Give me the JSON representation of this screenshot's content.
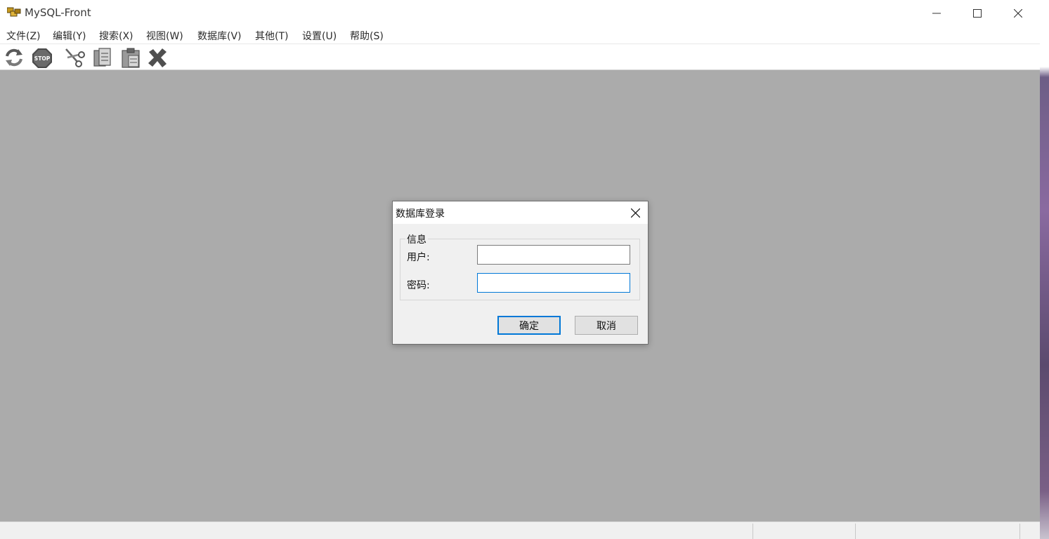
{
  "app": {
    "title": "MySQL-Front"
  },
  "window_controls": {
    "minimize_icon": "minimize-icon",
    "maximize_icon": "maximize-icon",
    "close_icon": "close-icon"
  },
  "menu": {
    "items": [
      "文件(Z)",
      "编辑(Y)",
      "搜索(X)",
      "视图(W)",
      "数据库(V)",
      "其他(T)",
      "设置(U)",
      "帮助(S)"
    ]
  },
  "toolbar": {
    "icons": [
      "refresh-icon",
      "stop-icon",
      "cut-icon",
      "copy-icon",
      "paste-icon",
      "delete-icon"
    ],
    "stop_text": "STOP"
  },
  "dialog": {
    "title": "数据库登录",
    "group_label": "信息",
    "user_label": "用户:",
    "user_value": "",
    "password_label": "密码:",
    "password_value": "",
    "ok_label": "确定",
    "cancel_label": "取消"
  },
  "colors": {
    "workspace": "#ababab",
    "accent": "#0078d7"
  }
}
